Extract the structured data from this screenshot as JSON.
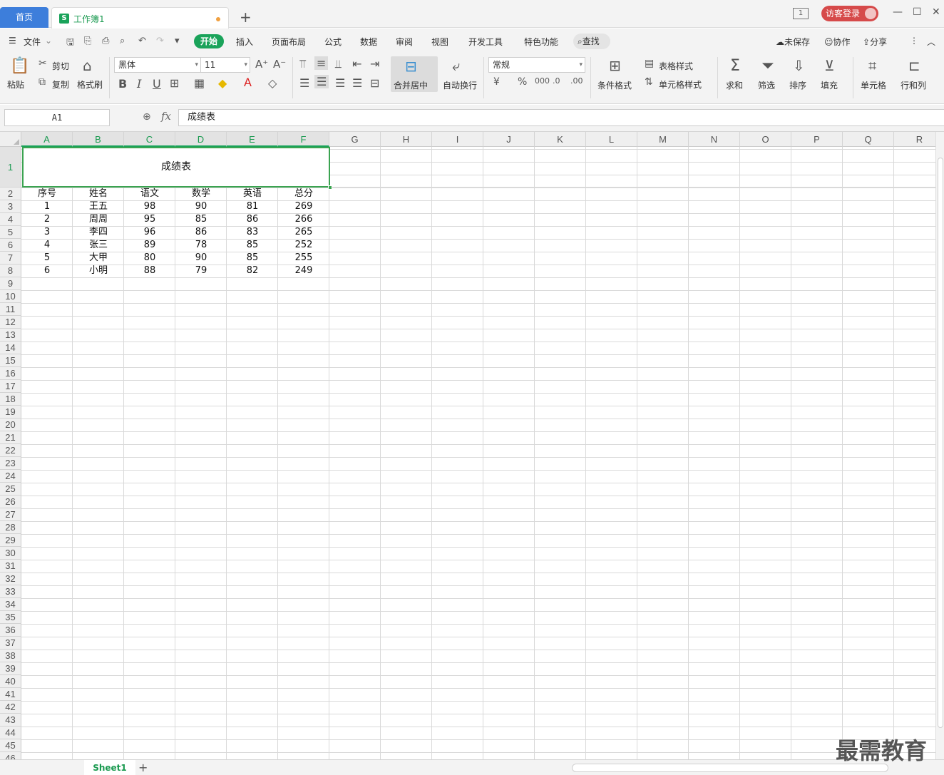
{
  "titlebar": {
    "home_tab": "首页",
    "workbook_tab": "工作簿1",
    "page_indicator": "1",
    "login": "访客登录"
  },
  "menubar": {
    "file": "文件",
    "items": [
      "开始",
      "插入",
      "页面布局",
      "公式",
      "数据",
      "审阅",
      "视图",
      "开发工具",
      "特色功能"
    ],
    "search": "查找",
    "unsaved": "未保存",
    "collab": "协作",
    "share": "分享"
  },
  "ribbon": {
    "paste": "粘贴",
    "cut": "剪切",
    "copy": "复制",
    "format_painter": "格式刷",
    "font_name": "黑体",
    "font_size": "11",
    "merge_center": "合并居中",
    "wrap_text": "自动换行",
    "number_format": "常规",
    "cond_format": "条件格式",
    "table_style": "表格样式",
    "cell_style": "单元格样式",
    "sum": "求和",
    "filter": "筛选",
    "sort": "排序",
    "fill": "填充",
    "cell": "单元格",
    "rowcol": "行和列"
  },
  "formula": {
    "name_box": "A1",
    "fx": "fx",
    "content": "成绩表"
  },
  "columns": [
    "A",
    "B",
    "C",
    "D",
    "E",
    "F",
    "G",
    "H",
    "I",
    "J",
    "K",
    "L",
    "M",
    "N",
    "O",
    "P",
    "Q",
    "R"
  ],
  "sheet": {
    "title": "成绩表",
    "headers": [
      "序号",
      "姓名",
      "语文",
      "数学",
      "英语",
      "总分"
    ],
    "rows": [
      [
        "1",
        "王五",
        "98",
        "90",
        "81",
        "269"
      ],
      [
        "2",
        "周周",
        "95",
        "85",
        "86",
        "266"
      ],
      [
        "3",
        "李四",
        "96",
        "86",
        "83",
        "265"
      ],
      [
        "4",
        "张三",
        "89",
        "78",
        "85",
        "252"
      ],
      [
        "5",
        "大甲",
        "80",
        "90",
        "85",
        "255"
      ],
      [
        "6",
        "小明",
        "88",
        "79",
        "82",
        "249"
      ]
    ]
  },
  "bottom": {
    "sheet_tab": "Sheet1"
  },
  "watermark": "最需教育",
  "colors": {
    "accent_green": "#1aa35a",
    "home_tab_blue": "#3d7edb",
    "login_red": "#d64a4a"
  }
}
